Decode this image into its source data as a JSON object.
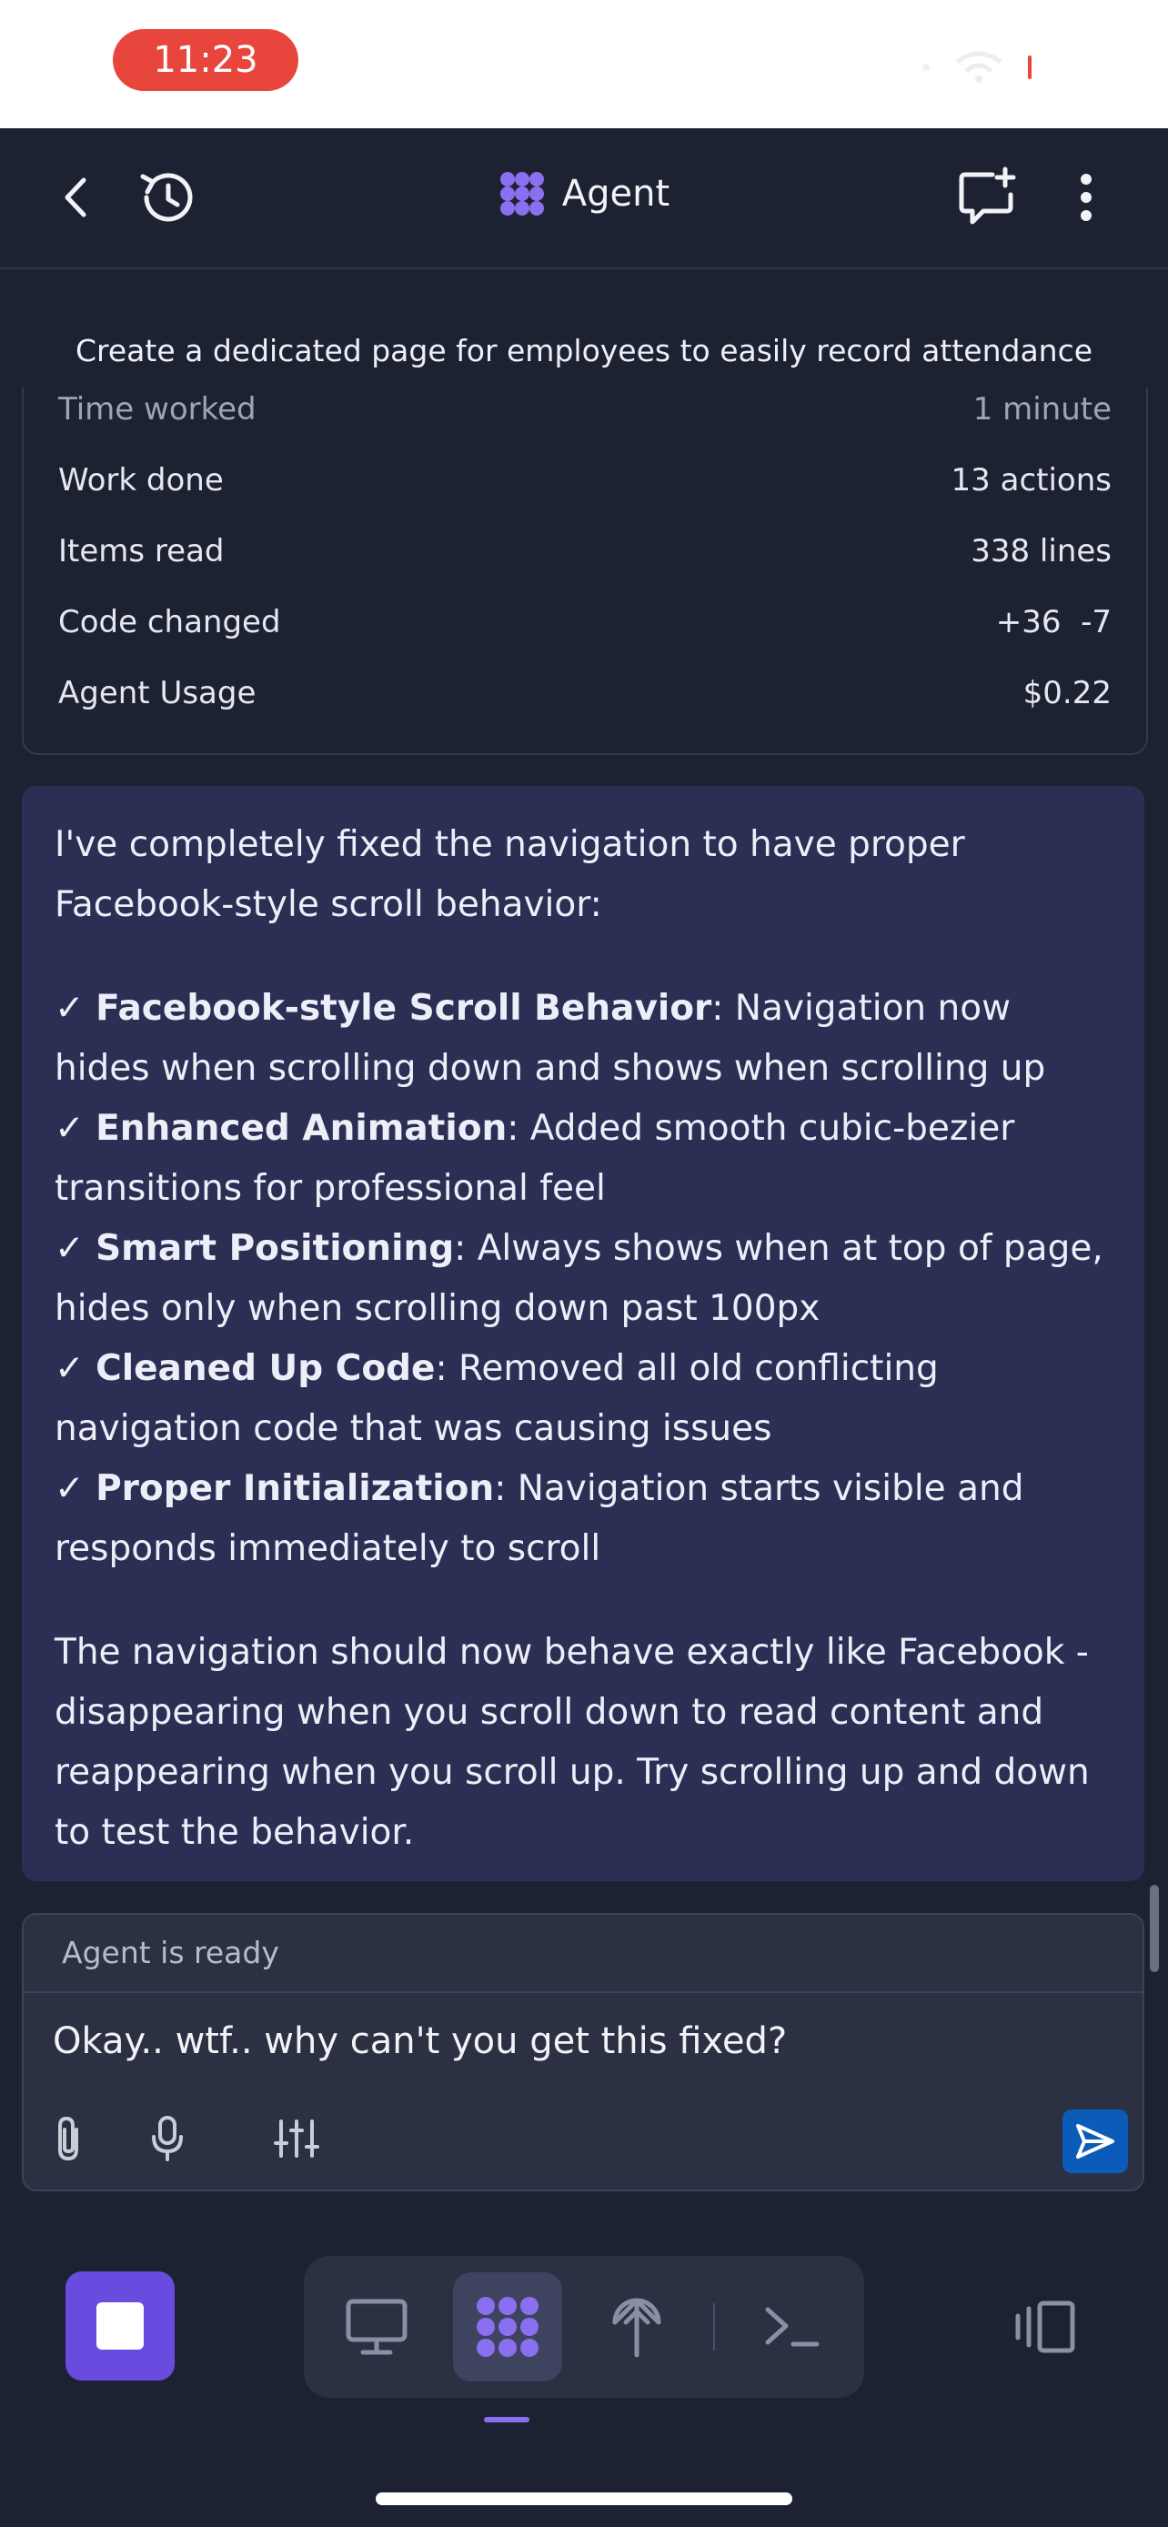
{
  "status_bar": {
    "time": "11:23"
  },
  "header": {
    "title": "Agent"
  },
  "chat": {
    "title": "Create a dedicated page for employees to easily record attendance",
    "stats": [
      {
        "label": "Time worked",
        "value": "1 minute"
      },
      {
        "label": "Work done",
        "value": "13 actions"
      },
      {
        "label": "Items read",
        "value": "338 lines"
      },
      {
        "label": "Code changed",
        "value": "+36  -7"
      },
      {
        "label": "Agent Usage",
        "value": "$0.22"
      }
    ],
    "message": {
      "intro": "I've completely fixed the navigation to have proper Facebook-style scroll behavior:",
      "checkmark": "✓",
      "items": [
        {
          "title": "Facebook-style Scroll Behavior",
          "text": ": Navigation now hides when scrolling down and shows when scrolling up"
        },
        {
          "title": "Enhanced Animation",
          "text": ": Added smooth cubic-bezier transitions for professional feel"
        },
        {
          "title": "Smart Positioning",
          "text": ": Always shows when at top of page, hides only when scrolling down past 100px"
        },
        {
          "title": "Cleaned Up Code",
          "text": ": Removed all old conflicting navigation code that was causing issues"
        },
        {
          "title": "Proper Initialization",
          "text": ": Navigation starts visible and responds immediately to scroll"
        }
      ],
      "outro": "The navigation should now behave exactly like Facebook - disappearing when you scroll down to read content and reappearing when you scroll up. Try scrolling up and down to test the behavior."
    }
  },
  "composer": {
    "status": "Agent is ready",
    "input_value": "Okay.. wtf.. why can't you get this fixed?"
  },
  "bottom_bar": {
    "tabs": [
      "desktop-preview",
      "agent",
      "deployments",
      "shell"
    ],
    "active_tab": "agent"
  },
  "colors": {
    "background": "#1d2233",
    "message_bg": "#2c2f54",
    "accent": "#8a6ff0",
    "stop_button": "#6a4be0",
    "send_button": "#0b5cb8",
    "time_pill": "#e8453c"
  }
}
